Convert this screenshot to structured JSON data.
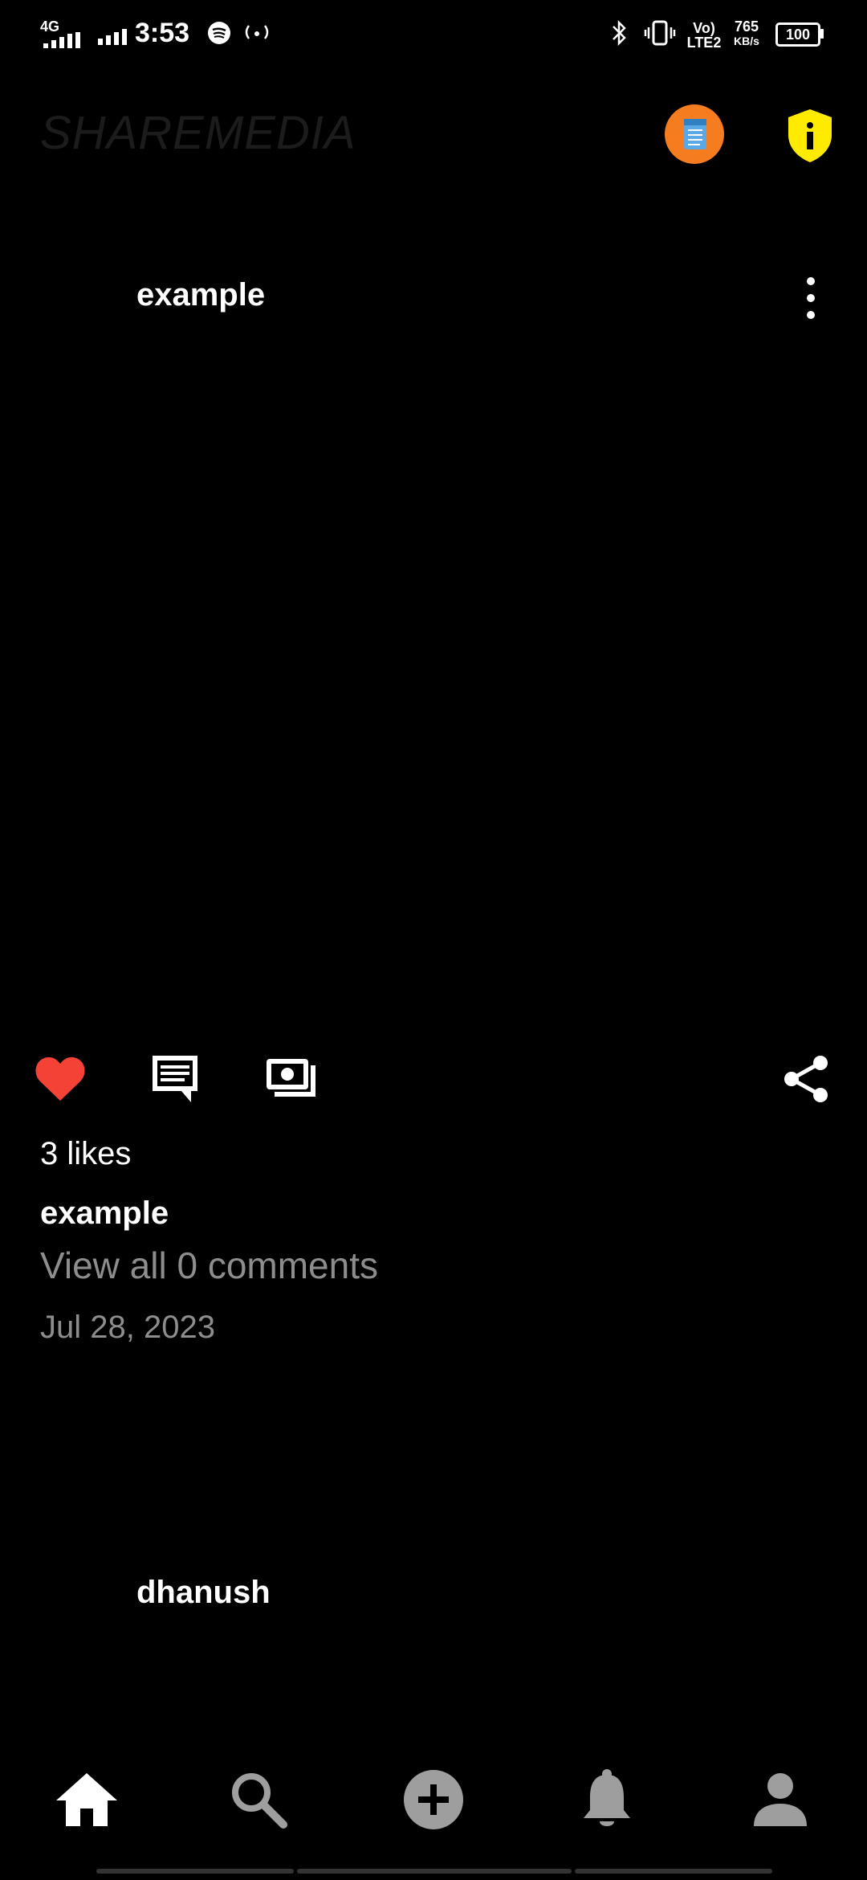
{
  "status_bar": {
    "network": "4G",
    "time": "3:53",
    "volte": "Vo)\nLTE2",
    "speed_value": "765",
    "speed_unit": "KB/s",
    "battery": "100"
  },
  "app_bar": {
    "logo_text": "SHAREMEDIA",
    "icon_left": "notes-app-icon",
    "icon_right": "info-shield-icon"
  },
  "post": {
    "username": "example",
    "likes_text": "3 likes",
    "caption_username": "example",
    "view_comments": "View all 0 comments",
    "date": "Jul 28, 2023",
    "liked": true
  },
  "next_post": {
    "username": "dhanush"
  },
  "colors": {
    "like_red": "#f44336",
    "muted_text": "#8d8d8d",
    "nav_inactive": "#9e9e9e",
    "shield_yellow": "#ffeb00"
  },
  "bottom_nav": [
    {
      "name": "home",
      "icon": "home-icon",
      "active": true
    },
    {
      "name": "search",
      "icon": "search-icon",
      "active": false
    },
    {
      "name": "add",
      "icon": "add-circle-icon",
      "active": false
    },
    {
      "name": "notifications",
      "icon": "bell-icon",
      "active": false
    },
    {
      "name": "profile",
      "icon": "person-icon",
      "active": false
    }
  ]
}
